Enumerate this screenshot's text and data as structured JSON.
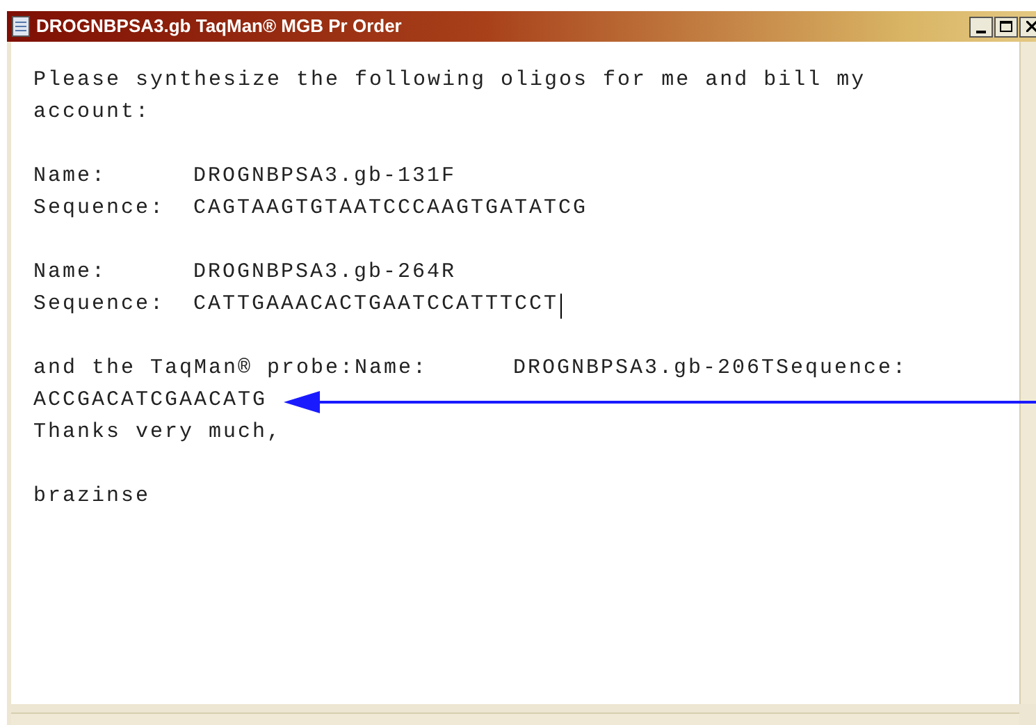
{
  "window": {
    "title": "DROGNBPSA3.gb TaqMan® MGB Pr Order"
  },
  "groups": [
    [
      {
        "kind": "text",
        "text": "Please synthesize the following oligos for me and bill my"
      },
      {
        "kind": "text",
        "text": "account:"
      }
    ],
    [
      {
        "kind": "field",
        "label": "Name:",
        "value": "DROGNBPSA3.gb-131F"
      },
      {
        "kind": "field",
        "label": "Sequence:",
        "value": "CAGTAAGTGTAATCCCAAGTGATATCG"
      }
    ],
    [
      {
        "kind": "field",
        "label": "Name:",
        "value": "DROGNBPSA3.gb-264R"
      },
      {
        "kind": "field",
        "label": "Sequence:",
        "value": "CATTGAAACACTGAATCCATTTCCT",
        "caret": true
      }
    ],
    [
      {
        "kind": "wide",
        "label": "and the TaqMan® probe:Name:",
        "value": "DROGNBPSA3.gb-206TSequence:"
      },
      {
        "kind": "text",
        "text": "ACCGACATCGAACATG",
        "arrow": true
      },
      {
        "kind": "text",
        "text": "Thanks very much,"
      }
    ],
    [
      {
        "kind": "text",
        "text": "brazinse"
      }
    ]
  ]
}
